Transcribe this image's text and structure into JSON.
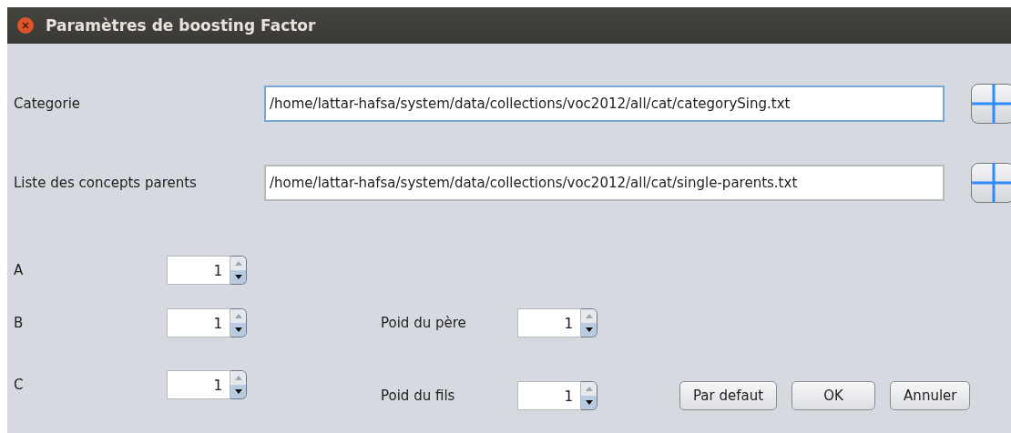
{
  "window": {
    "title": "Paramètres de boosting Factor"
  },
  "files": [
    {
      "label": "Categorie",
      "value": "/home/lattar-hafsa/system/data/collections/voc2012/all/cat/categorySing.txt",
      "focused": true
    },
    {
      "label": "Liste des concepts parents",
      "value": "/home/lattar-hafsa/system/data/collections/voc2012/all/cat/single-parents.txt",
      "focused": false
    }
  ],
  "left_spinners": [
    {
      "label": "A",
      "value": "1"
    },
    {
      "label": "B",
      "value": "1"
    },
    {
      "label": "C",
      "value": "1"
    }
  ],
  "right_spinners": [
    {
      "label": "Poid du père",
      "value": "1"
    },
    {
      "label": "Poid du fils",
      "value": "1"
    }
  ],
  "buttons": [
    "Par defaut",
    "OK",
    "Annuler"
  ]
}
